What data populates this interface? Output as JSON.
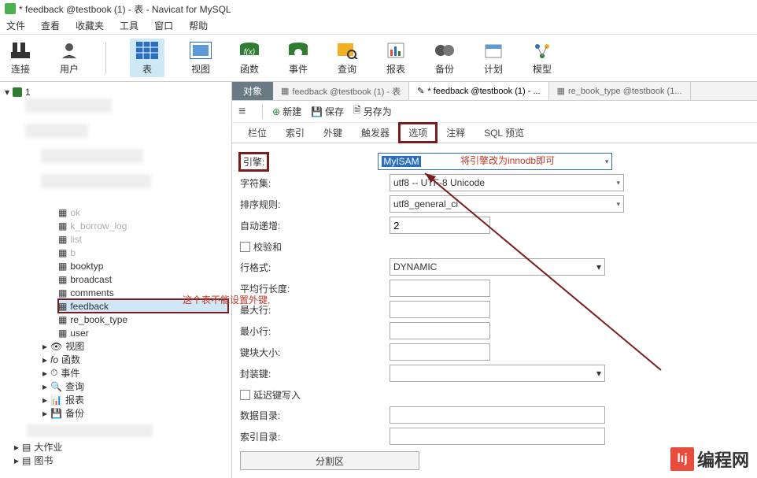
{
  "window": {
    "title": "* feedback @testbook (1) - 表 - Navicat for MySQL"
  },
  "menu": {
    "file": "文件",
    "view": "查看",
    "favorites": "收藏夹",
    "tools": "工具",
    "window": "窗口",
    "help": "帮助"
  },
  "toolbar": {
    "connect": "连接",
    "user": "用户",
    "table": "表",
    "view": "视图",
    "function": "函数",
    "event": "事件",
    "query": "查询",
    "report": "报表",
    "backup": "备份",
    "schedule": "计划",
    "model": "模型"
  },
  "sidebar": {
    "conn": "1",
    "tables": {
      "book": "ok",
      "borrow": "k_borrow_log",
      "list": "list",
      "b_other": "b",
      "booktyp": "booktyp",
      "broadcast": "broadcast",
      "comments": "comments",
      "feedback": "feedback",
      "re_book_type": "re_book_type",
      "user": "user"
    },
    "nodes": {
      "view": "视图",
      "func": "函数",
      "event": "事件",
      "query": "查询",
      "report": "报表",
      "backup": "备份"
    },
    "bottom1": "大作业",
    "bottom2": "图书"
  },
  "tabs": {
    "obj": "对象",
    "t1": "feedback @testbook (1) - 表",
    "t2": "* feedback @testbook (1) - ...",
    "t3": "re_book_type @testbook (1..."
  },
  "actions": {
    "new": "新建",
    "save": "保存",
    "saveas": "另存为"
  },
  "subtabs": {
    "fields": "栏位",
    "index": "索引",
    "fk": "外键",
    "trigger": "触发器",
    "options": "选项",
    "comment": "注释",
    "sql": "SQL 预览"
  },
  "form": {
    "engine": "引擎:",
    "engine_val": "MyISAM",
    "charset": "字符集:",
    "charset_val": "utf8 -- UTF-8 Unicode",
    "collation": "排序规则:",
    "collation_val": "utf8_general_ci",
    "autoinc": "自动递增:",
    "autoinc_val": "2",
    "checksum": "校验和",
    "rowformat": "行格式:",
    "rowformat_val": "DYNAMIC",
    "avgrow": "平均行长度:",
    "maxrow": "最大行:",
    "minrow": "最小行:",
    "keyblock": "键块大小:",
    "pack": "封装键:",
    "delay": "延迟键写入",
    "datadir": "数据目录:",
    "indexdir": "索引目录:",
    "partition": "分割区"
  },
  "annotations": {
    "a1": "这个表不能设置外键,",
    "a2": "将引擎改为innodb即可"
  },
  "watermark": "编程网"
}
